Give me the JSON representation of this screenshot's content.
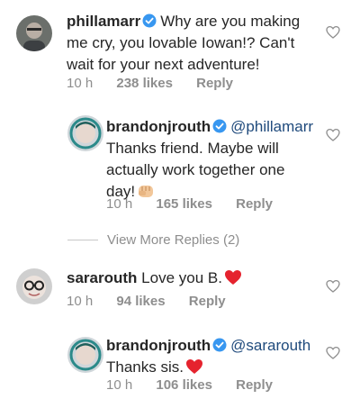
{
  "icons": {
    "verified": "verified-badge-icon",
    "like": "heart-outline-icon",
    "fist": "oncoming-fist-emoji",
    "heart": "red-heart-emoji"
  },
  "colors": {
    "verified_blue": "#3897f0",
    "mention": "#1f4a7c",
    "meta_gray": "#8e8e8e",
    "heart_red": "#e5232e"
  },
  "comments": [
    {
      "username": "phillamarr",
      "verified": true,
      "text_line1": "Why are you making",
      "text_line2": "me cry, you lovable Iowan!? Can't",
      "text_line3": "wait for your next adventure!",
      "time": "10 h",
      "likes": "238 likes",
      "reply": "Reply"
    },
    {
      "username": "brandonjrouth",
      "verified": true,
      "mention": "@phillamarr",
      "text_line1": "Thanks friend. Maybe will",
      "text_line2": "actually work together one",
      "text_line3": "day!",
      "time": "10 h",
      "likes": "165 likes",
      "reply": "Reply"
    },
    {
      "username": "sararouth",
      "verified": false,
      "text": "Love you B.",
      "time": "10 h",
      "likes": "94 likes",
      "reply": "Reply"
    },
    {
      "username": "brandonjrouth",
      "verified": true,
      "mention": "@sararouth",
      "text": "Thanks sis.",
      "time": "10 h",
      "likes": "106 likes",
      "reply": "Reply"
    }
  ],
  "view_more": "View More Replies (2)"
}
